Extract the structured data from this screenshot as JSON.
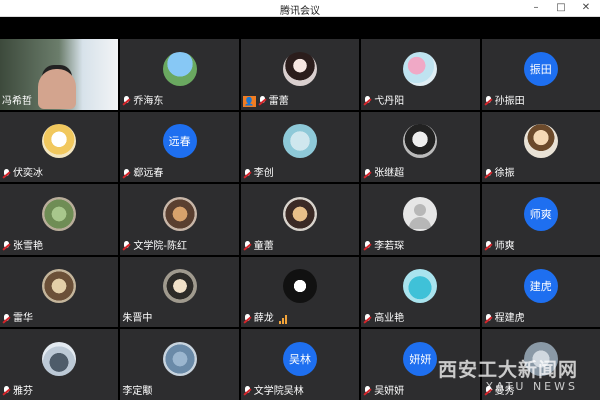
{
  "window": {
    "title": "腾讯会议",
    "controls": {
      "minimize": "–",
      "maximize": "□",
      "close": "✕"
    }
  },
  "participants": [
    {
      "name": "冯希哲",
      "avatar_type": "video"
    },
    {
      "name": "乔海东",
      "avatar_type": "image"
    },
    {
      "name": "雷蕾",
      "avatar_type": "image",
      "host": true
    },
    {
      "name": "弋丹阳",
      "avatar_type": "image"
    },
    {
      "name": "孙振田",
      "avatar_text": "振田",
      "avatar_type": "text"
    },
    {
      "name": "伏奕冰",
      "avatar_type": "image"
    },
    {
      "name": "郄远春",
      "avatar_text": "远春",
      "avatar_type": "text"
    },
    {
      "name": "李创",
      "avatar_type": "image"
    },
    {
      "name": "张继超",
      "avatar_type": "image"
    },
    {
      "name": "徐振",
      "avatar_type": "image"
    },
    {
      "name": "张雪艳",
      "avatar_type": "image"
    },
    {
      "name": "文学院-陈红",
      "avatar_type": "image"
    },
    {
      "name": "童蕾",
      "avatar_type": "image"
    },
    {
      "name": "李若琛",
      "avatar_type": "placeholder"
    },
    {
      "name": "师爽",
      "avatar_text": "师爽",
      "avatar_type": "text"
    },
    {
      "name": "雷华",
      "avatar_type": "image"
    },
    {
      "name": "朱晋中",
      "avatar_type": "image"
    },
    {
      "name": "薛龙",
      "avatar_type": "image",
      "speaking": true
    },
    {
      "name": "高业艳",
      "avatar_type": "image"
    },
    {
      "name": "程建虎",
      "avatar_text": "建虎",
      "avatar_type": "text"
    },
    {
      "name": "雅芬",
      "avatar_type": "image"
    },
    {
      "name": "李定颙",
      "avatar_type": "image"
    },
    {
      "name": "文学院吴林",
      "avatar_text": "吴林",
      "avatar_type": "text"
    },
    {
      "name": "吴妍妍",
      "avatar_text": "妍妍",
      "avatar_type": "text"
    },
    {
      "name": "曼秀",
      "avatar_type": "image"
    }
  ],
  "watermark": {
    "cn": "西安工大新闻网",
    "en": "XATU NEWS"
  },
  "colors": {
    "tile_bg": "#2d2d2f",
    "avatar_blue": "#1e6ff0",
    "mute_red": "#d5242a",
    "host_orange": "#f07d23"
  }
}
